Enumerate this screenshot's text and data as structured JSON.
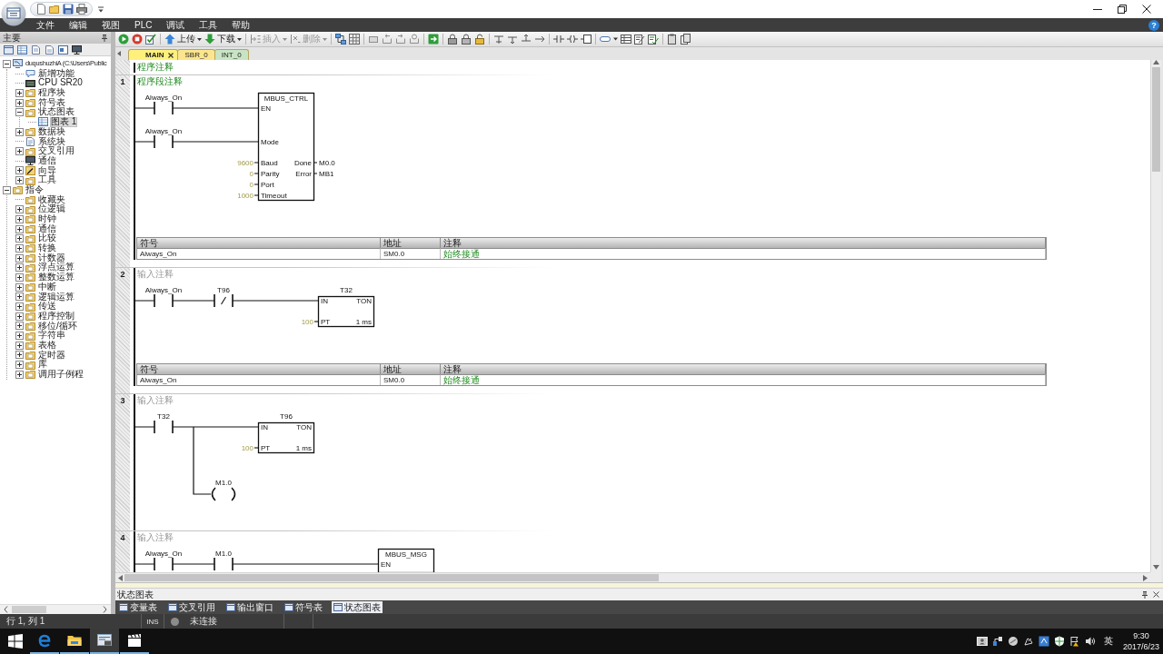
{
  "menu_bar": {
    "items": [
      "文件",
      "编辑",
      "视图",
      "PLC",
      "调试",
      "工具",
      "帮助"
    ],
    "help": "?"
  },
  "project_panel": {
    "title": "主要",
    "tree": [
      {
        "label": "duqushuzhiA (C:\\Users\\Public",
        "kind": "project",
        "expanded": true,
        "selected": false,
        "children": [
          {
            "label": "新增功能",
            "kind": "info",
            "selected": false
          },
          {
            "label": "CPU SR20",
            "kind": "cpu",
            "selected": false
          },
          {
            "label": "程序块",
            "kind": "folder",
            "expanded": false,
            "selected": false
          },
          {
            "label": "符号表",
            "kind": "folder",
            "expanded": false,
            "selected": false
          },
          {
            "label": "状态图表",
            "kind": "folder",
            "expanded": true,
            "selected": false,
            "children": [
              {
                "label": "图表 1",
                "kind": "chart",
                "selected": true
              }
            ]
          },
          {
            "label": "数据块",
            "kind": "folder",
            "expanded": false,
            "selected": false
          },
          {
            "label": "系统块",
            "kind": "page",
            "selected": false
          },
          {
            "label": "交叉引用",
            "kind": "folder",
            "expanded": false,
            "selected": false
          },
          {
            "label": "通信",
            "kind": "network",
            "selected": false
          },
          {
            "label": "向导",
            "kind": "wand",
            "expanded": false,
            "selected": false
          },
          {
            "label": "工具",
            "kind": "folder",
            "expanded": false,
            "selected": false
          }
        ]
      },
      {
        "label": "指令",
        "kind": "folder",
        "expanded": true,
        "selected": false,
        "children": [
          {
            "label": "收藏夹",
            "kind": "folder",
            "selected": false
          },
          {
            "label": "位逻辑",
            "kind": "folder",
            "expanded": false,
            "selected": false
          },
          {
            "label": "时钟",
            "kind": "folder",
            "expanded": false,
            "selected": false
          },
          {
            "label": "通信",
            "kind": "folder",
            "expanded": false,
            "selected": false
          },
          {
            "label": "比较",
            "kind": "folder",
            "expanded": false,
            "selected": false
          },
          {
            "label": "转换",
            "kind": "folder",
            "expanded": false,
            "selected": false
          },
          {
            "label": "计数器",
            "kind": "folder",
            "expanded": false,
            "selected": false
          },
          {
            "label": "浮点运算",
            "kind": "folder",
            "expanded": false,
            "selected": false
          },
          {
            "label": "整数运算",
            "kind": "folder",
            "expanded": false,
            "selected": false
          },
          {
            "label": "中断",
            "kind": "folder",
            "expanded": false,
            "selected": false
          },
          {
            "label": "逻辑运算",
            "kind": "folder",
            "expanded": false,
            "selected": false
          },
          {
            "label": "传送",
            "kind": "folder",
            "expanded": false,
            "selected": false
          },
          {
            "label": "程序控制",
            "kind": "folder",
            "expanded": false,
            "selected": false
          },
          {
            "label": "移位/循环",
            "kind": "folder",
            "expanded": false,
            "selected": false
          },
          {
            "label": "字符串",
            "kind": "folder",
            "expanded": false,
            "selected": false
          },
          {
            "label": "表格",
            "kind": "folder",
            "expanded": false,
            "selected": false
          },
          {
            "label": "定时器",
            "kind": "folder",
            "expanded": false,
            "selected": false
          },
          {
            "label": "库",
            "kind": "folder",
            "expanded": false,
            "selected": false
          },
          {
            "label": "调用子例程",
            "kind": "folder",
            "expanded": false,
            "selected": false
          }
        ]
      }
    ]
  },
  "toolbar": {
    "buttons": [
      {
        "kind": "upload",
        "label": "上传",
        "disabled": false
      },
      {
        "kind": "download",
        "label": "下载",
        "disabled": false
      },
      {
        "kind": "insert",
        "label": "插入",
        "disabled": true
      },
      {
        "kind": "delete",
        "label": "删除",
        "disabled": true
      }
    ]
  },
  "tabs": [
    {
      "label": "MAIN",
      "selected": true,
      "color": "#fff07c"
    },
    {
      "label": "SBR_0",
      "selected": false,
      "color": "#fbe58e"
    },
    {
      "label": "INT_0",
      "selected": false,
      "color": "#c8e4c4"
    }
  ],
  "editor": {
    "program_comment": "程序注释",
    "networks": [
      {
        "number": "1",
        "comment": "程序段注释",
        "rungs": [
          {
            "contacts": [
              {
                "kind": "open",
                "label": "Always_On"
              }
            ]
          },
          {
            "contacts": [
              {
                "kind": "open",
                "label": "Always_On"
              }
            ]
          }
        ],
        "block": {
          "kind": "call",
          "name": "MBUS_CTRL",
          "inputs": [
            {
              "pin": "EN"
            },
            {
              "pin": "Mode"
            },
            {
              "pin": "Baud",
              "value": "9600"
            },
            {
              "pin": "Parity",
              "value": "0"
            },
            {
              "pin": "Port",
              "value": "0"
            },
            {
              "pin": "Timeout",
              "value": "1000"
            }
          ],
          "outputs": [
            {
              "pin": "Done",
              "value": "M0.0"
            },
            {
              "pin": "Error",
              "value": "MB1"
            }
          ]
        },
        "symbols": {
          "columns": [
            "符号",
            "地址",
            "注释"
          ],
          "rows": [
            [
              "Always_On",
              "SM0.0",
              "始终接通"
            ]
          ]
        }
      },
      {
        "number": "2",
        "placeholder": "输入注释",
        "rungs": [
          {
            "contacts": [
              {
                "kind": "open",
                "label": "Always_On"
              },
              {
                "kind": "closed",
                "label": "T96"
              }
            ]
          }
        ],
        "block": {
          "kind": "timer",
          "name": "T32",
          "type": "TON",
          "resolution": "1 ms",
          "inputs": [
            {
              "pin": "IN"
            },
            {
              "pin": "PT",
              "value": "100"
            }
          ]
        },
        "symbols": {
          "columns": [
            "符号",
            "地址",
            "注释"
          ],
          "rows": [
            [
              "Always_On",
              "SM0.0",
              "始终接通"
            ]
          ]
        }
      },
      {
        "number": "3",
        "placeholder": "输入注释",
        "rungs": [
          {
            "contacts": [
              {
                "kind": "open",
                "label": "T32"
              }
            ]
          }
        ],
        "block": {
          "kind": "timer",
          "name": "T96",
          "type": "TON",
          "resolution": "1 ms",
          "inputs": [
            {
              "pin": "IN"
            },
            {
              "pin": "PT",
              "value": "100"
            }
          ]
        },
        "branch_coil": {
          "label": "M1.0"
        }
      },
      {
        "number": "4",
        "placeholder": "输入注释",
        "rungs": [
          {
            "contacts": [
              {
                "kind": "open",
                "label": "Always_On"
              },
              {
                "kind": "open",
                "label": "M1.0"
              }
            ]
          }
        ],
        "block": {
          "kind": "call",
          "name": "MBUS_MSG",
          "inputs": [
            {
              "pin": "EN"
            }
          ]
        }
      }
    ]
  },
  "bottom_panel": {
    "title": "状态图表",
    "tabs": [
      {
        "label": "变量表",
        "selected": false
      },
      {
        "label": "交叉引用",
        "selected": false
      },
      {
        "label": "输出窗口",
        "selected": false
      },
      {
        "label": "符号表",
        "selected": false
      },
      {
        "label": "状态图表",
        "selected": true
      }
    ]
  },
  "status_bar": {
    "position": "行 1, 列 1",
    "mode": "INS",
    "connection": {
      "connected": false,
      "label": "未连接"
    }
  },
  "taskbar": {
    "apps": [
      {
        "kind": "browser",
        "active": false,
        "running": true
      },
      {
        "kind": "explorer",
        "active": false,
        "running": true
      },
      {
        "kind": "plc",
        "active": true,
        "running": true
      },
      {
        "kind": "media",
        "active": false,
        "running": true
      }
    ],
    "input_language": "英",
    "time": "9:30",
    "date": "2017/6/23"
  }
}
